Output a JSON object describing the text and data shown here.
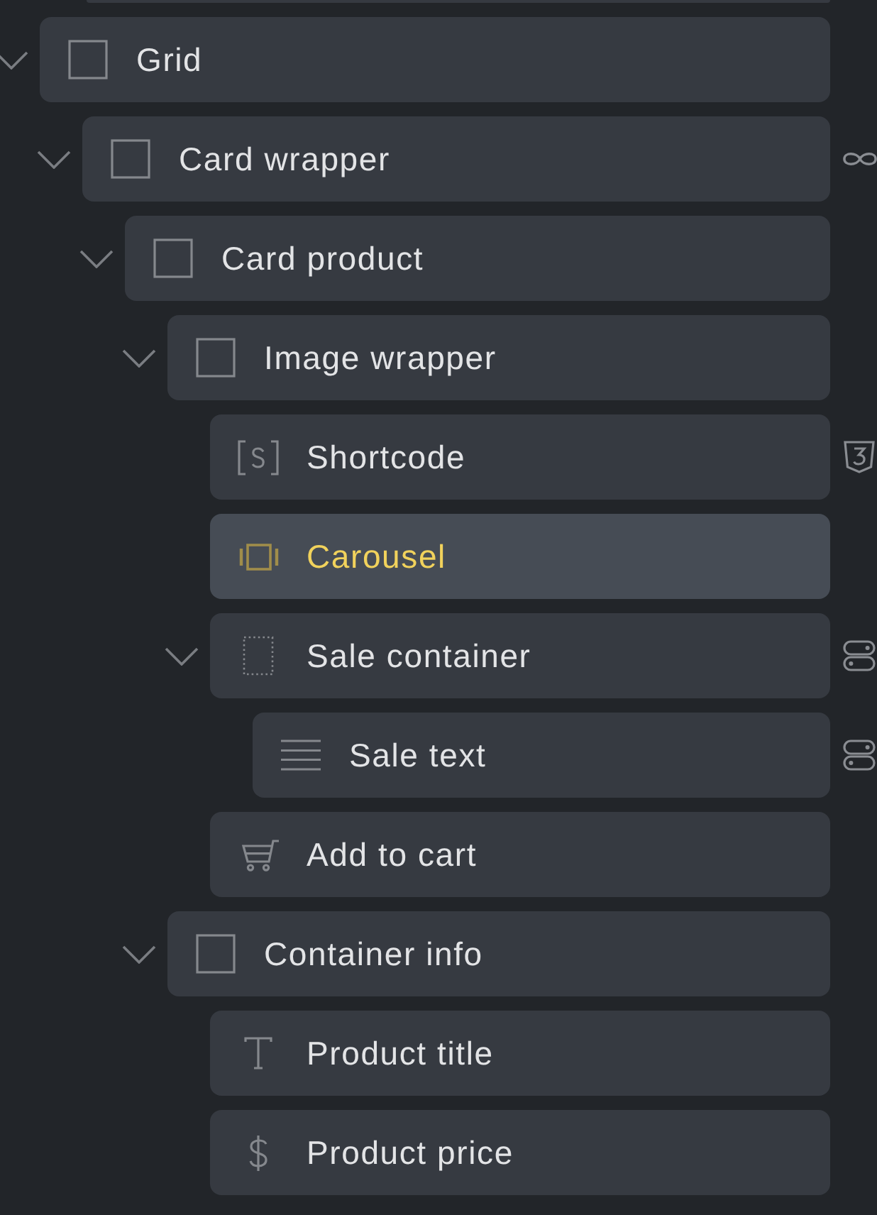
{
  "tree": [
    {
      "label": "Grid",
      "kind": "block",
      "selected": false,
      "expanded": true,
      "children": [
        {
          "label": "Card wrapper",
          "kind": "block",
          "badge": {
            "kind": "loop"
          },
          "selected": false,
          "expanded": true,
          "children": [
            {
              "label": "Card product",
              "kind": "block",
              "selected": false,
              "expanded": true,
              "children": [
                {
                  "label": "Image wrapper",
                  "kind": "block",
                  "selected": false,
                  "expanded": true,
                  "children": [
                    {
                      "label": "Shortcode",
                      "kind": "shortcode",
                      "badge": {
                        "kind": "css"
                      },
                      "selected": false
                    },
                    {
                      "label": "Carousel",
                      "kind": "carousel",
                      "selected": true
                    },
                    {
                      "label": "Sale container",
                      "kind": "div",
                      "badge": {
                        "kind": "condition"
                      },
                      "selected": false,
                      "expanded": true,
                      "children": [
                        {
                          "label": "Sale text",
                          "kind": "text",
                          "badge": {
                            "kind": "condition"
                          },
                          "selected": false
                        }
                      ]
                    },
                    {
                      "label": "Add to cart",
                      "kind": "cart",
                      "selected": false
                    }
                  ]
                },
                {
                  "label": "Container info",
                  "kind": "block",
                  "selected": false,
                  "expanded": true,
                  "children": [
                    {
                      "label": "Product title",
                      "kind": "heading",
                      "selected": false
                    },
                    {
                      "label": "Product price",
                      "kind": "price",
                      "selected": false
                    }
                  ]
                }
              ]
            }
          ]
        }
      ]
    }
  ]
}
